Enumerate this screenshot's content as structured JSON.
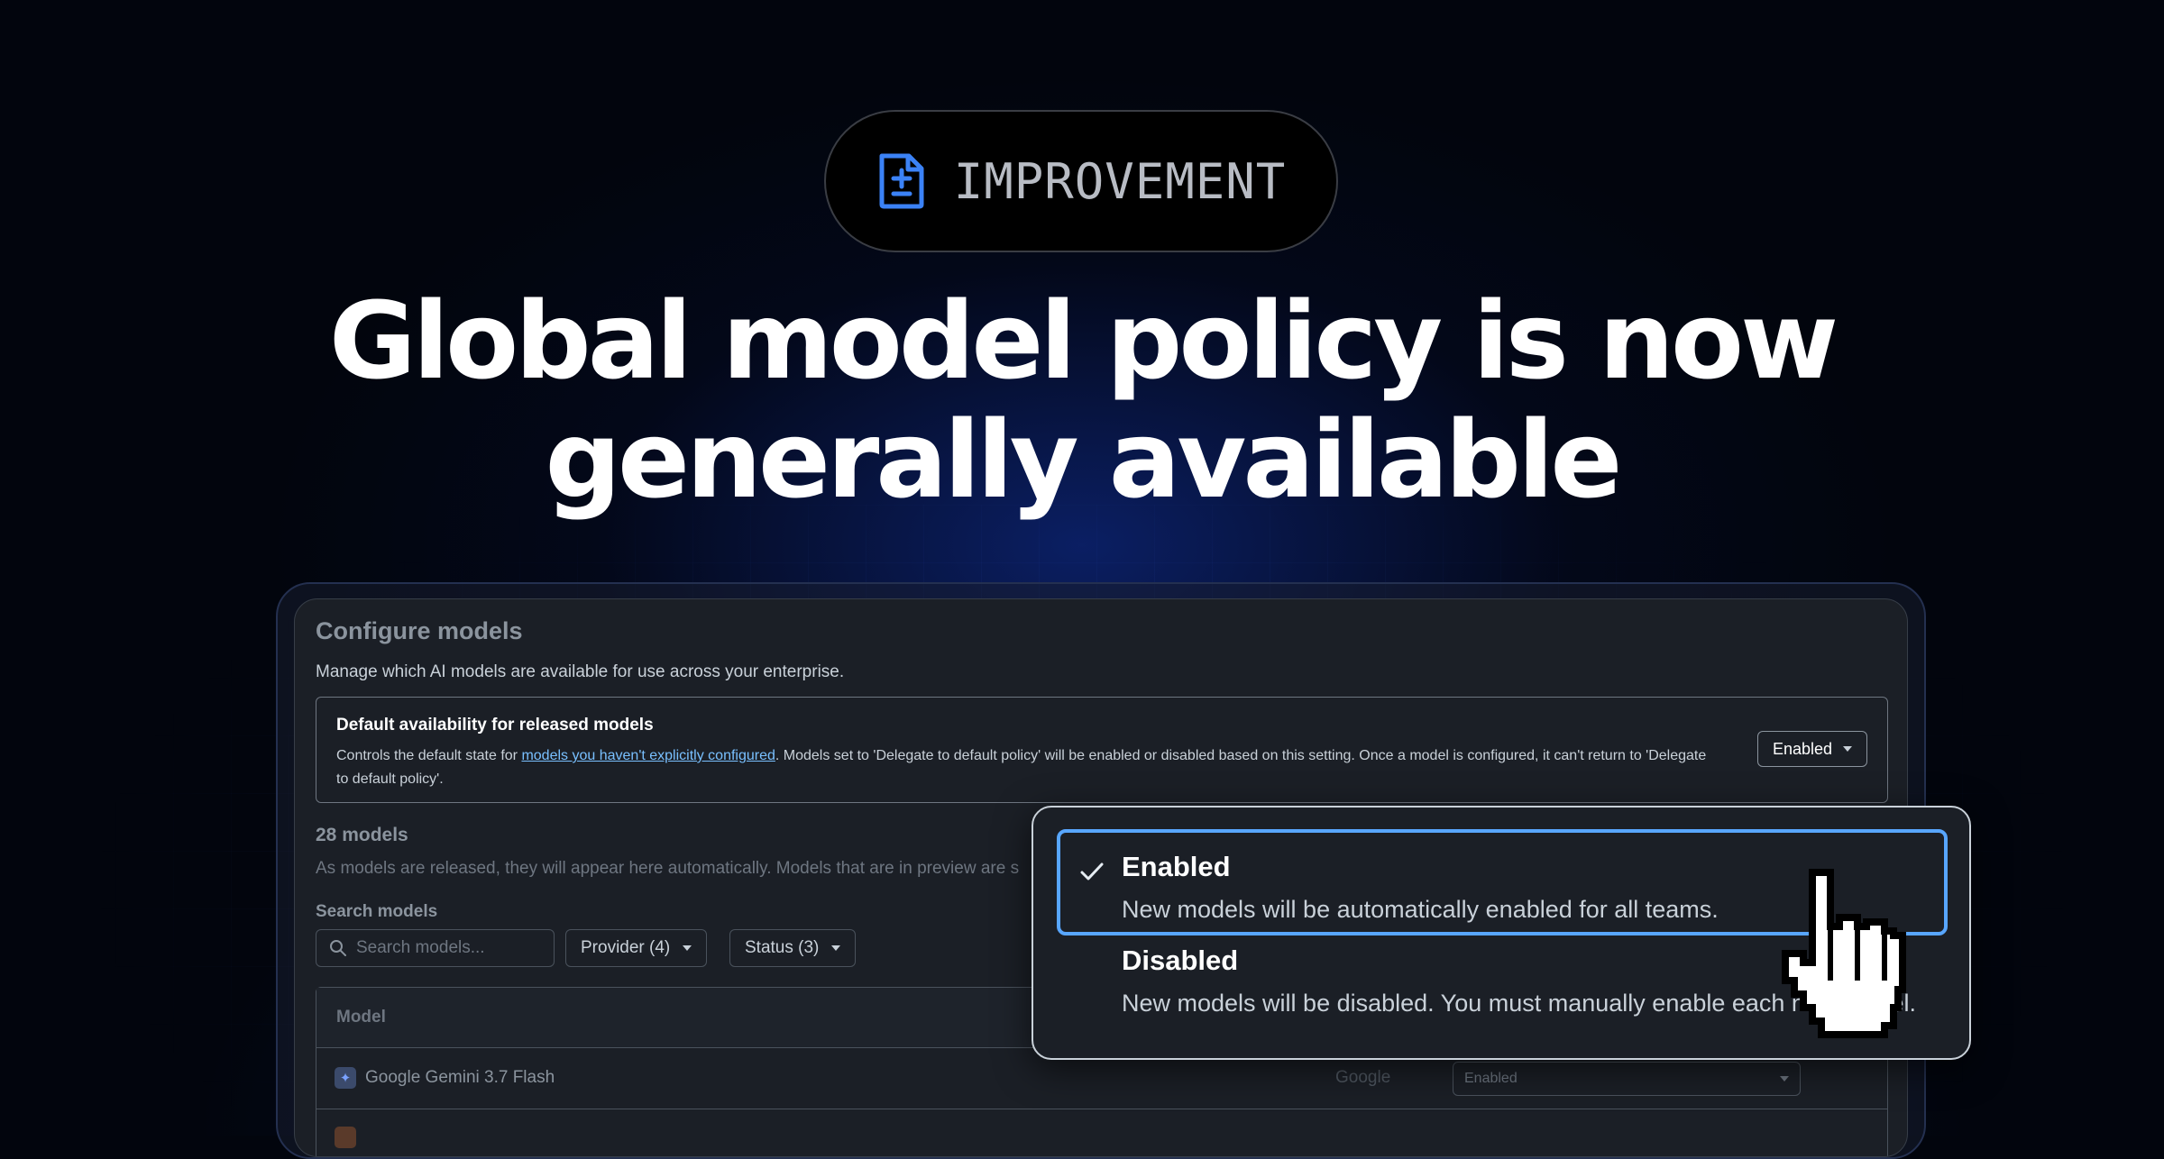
{
  "badge": {
    "label": "IMPROVEMENT",
    "icon": "document-diff-icon",
    "icon_color": "#3b82f6"
  },
  "headline": {
    "line1": "Global model policy is now",
    "line2": "generally available"
  },
  "panel": {
    "title": "Configure models",
    "description": "Manage which AI models are available for use across your enterprise.",
    "default_policy": {
      "title": "Default availability for released models",
      "text_before_link": "Controls the default state for ",
      "link_text": "models you haven't explicitly configured",
      "text_after_link": ". Models set to 'Delegate to default policy' will be enabled or disabled based on this setting. Once a model is configured, it can't return to 'Delegate to default policy'.",
      "selected_value": "Enabled"
    },
    "models_count": "28 models",
    "models_desc": "As models are released, they will appear here automatically. Models that are in preview are s",
    "search_label": "Search models",
    "search_placeholder": "Search models...",
    "filters": {
      "provider": "Provider (4)",
      "status": "Status (3)"
    },
    "table": {
      "column_model": "Model",
      "rows": [
        {
          "name": "Google Gemini 3.7 Flash",
          "provider": "Google",
          "status": "Enabled"
        }
      ]
    }
  },
  "dropdown": {
    "options": [
      {
        "title": "Enabled",
        "description": "New models will be automatically enabled for all teams.",
        "selected": true
      },
      {
        "title": "Disabled",
        "description": "New models will be disabled. You must manually enable each new model.",
        "selected": false
      }
    ]
  },
  "colors": {
    "accent": "#58a6ff",
    "link": "#79c0ff",
    "background": "#02050d"
  }
}
